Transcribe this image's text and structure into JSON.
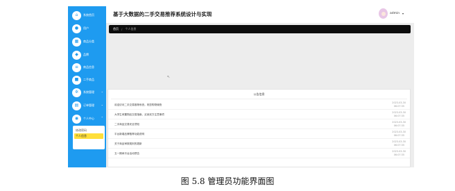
{
  "sidebar": {
    "items": [
      {
        "label": "系统首页",
        "icon": "home-icon",
        "glyph": "⌂",
        "has_caret": false
      },
      {
        "label": "用户",
        "icon": "user-icon",
        "glyph": "●",
        "has_caret": false
      },
      {
        "label": "商品分类",
        "icon": "grid-icon",
        "glyph": "▦",
        "has_caret": false
      },
      {
        "label": "品牌",
        "icon": "tag-icon",
        "glyph": "◆",
        "has_caret": false
      },
      {
        "label": "商品信息",
        "icon": "list-icon",
        "glyph": "≡",
        "has_caret": false
      },
      {
        "label": "二手商品",
        "icon": "box-icon",
        "glyph": "■",
        "has_caret": false
      },
      {
        "label": "系统管理",
        "icon": "gear-icon",
        "glyph": "✲",
        "has_caret": true
      },
      {
        "label": "订单管理",
        "icon": "order-icon",
        "glyph": "▤",
        "has_caret": true
      },
      {
        "label": "个人中心",
        "icon": "person-icon",
        "glyph": "◉",
        "has_caret": true
      }
    ],
    "submenu": [
      {
        "label": "修改密码",
        "active": false
      },
      {
        "label": "个人信息",
        "active": true
      }
    ]
  },
  "header": {
    "title": "基于大数据的二手交易推荐系统设计与实现",
    "user": "admin",
    "user_caret": "▾"
  },
  "breadcrumb": {
    "home": "首页",
    "separator": "/",
    "current": "个人信息"
  },
  "cursor_glyph": "↖",
  "notice_panel": {
    "title": "公告信息",
    "items": [
      {
        "title": "欢迎访问二手交易推荐系统，祝您购物愉快",
        "date": "2023-03-30",
        "time": "06:07:35"
      },
      {
        "title": "大学生闲置物品交易指南，买卖双方注意事项",
        "date": "2023-03-30",
        "time": "06:07:35"
      },
      {
        "title": "二手商品交易安全须知",
        "date": "2023-03-30",
        "time": "06:07:35"
      },
      {
        "title": "平台新增品牌推荐功能说明",
        "date": "2023-03-30",
        "time": "06:07:35"
      },
      {
        "title": "关于商品审核规则的更新",
        "date": "2023-03-30",
        "time": "06:07:35"
      },
      {
        "title": "五一期间平台活动预告",
        "date": "2023-03-30",
        "time": "06:07:35"
      }
    ]
  },
  "caption": "图 5.8 管理员功能界面图"
}
